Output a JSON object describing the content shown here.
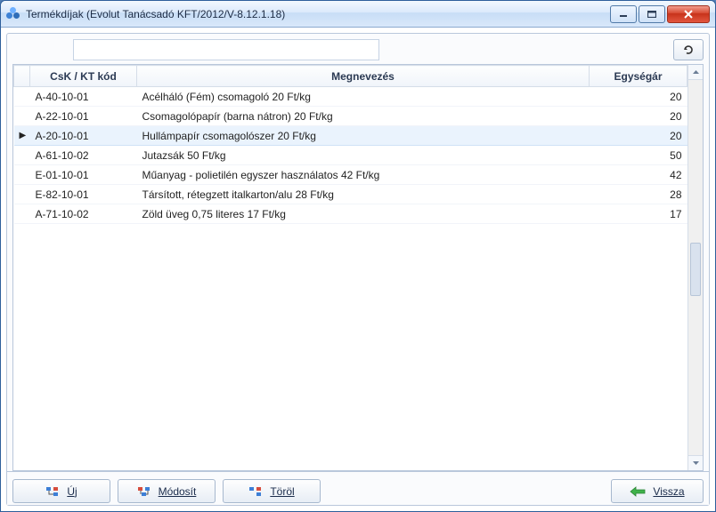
{
  "window": {
    "title": "Termékdíjak (Evolut Tanácsadó KFT/2012/V-8.12.1.18)"
  },
  "toolbar": {
    "search_value": "",
    "search_placeholder": ""
  },
  "grid": {
    "headers": {
      "code": "CsK / KT kód",
      "name": "Megnevezés",
      "price": "Egységár"
    },
    "rows": [
      {
        "code": "A-40-10-01",
        "name": "Acélháló (Fém) csomagoló  20 Ft/kg",
        "price": "20",
        "selected": false
      },
      {
        "code": "A-22-10-01",
        "name": "Csomagolópapír (barna nátron) 20 Ft/kg",
        "price": "20",
        "selected": false
      },
      {
        "code": "A-20-10-01",
        "name": "Hullámpapír csomagolószer 20 Ft/kg",
        "price": "20",
        "selected": true
      },
      {
        "code": "A-61-10-02",
        "name": "Jutazsák 50 Ft/kg",
        "price": "50",
        "selected": false
      },
      {
        "code": "E-01-10-01",
        "name": "Műanyag - polietilén egyszer használatos 42 Ft/kg",
        "price": "42",
        "selected": false
      },
      {
        "code": "E-82-10-01",
        "name": "Társított, rétegzett italkarton/alu  28 Ft/kg",
        "price": "28",
        "selected": false
      },
      {
        "code": "A-71-10-02",
        "name": "Zöld üveg 0,75 literes 17 Ft/kg",
        "price": "17",
        "selected": false
      }
    ]
  },
  "footer": {
    "new_label": "Új",
    "edit_label": "Módosít",
    "delete_label": "Töröl",
    "back_label": "Vissza"
  }
}
